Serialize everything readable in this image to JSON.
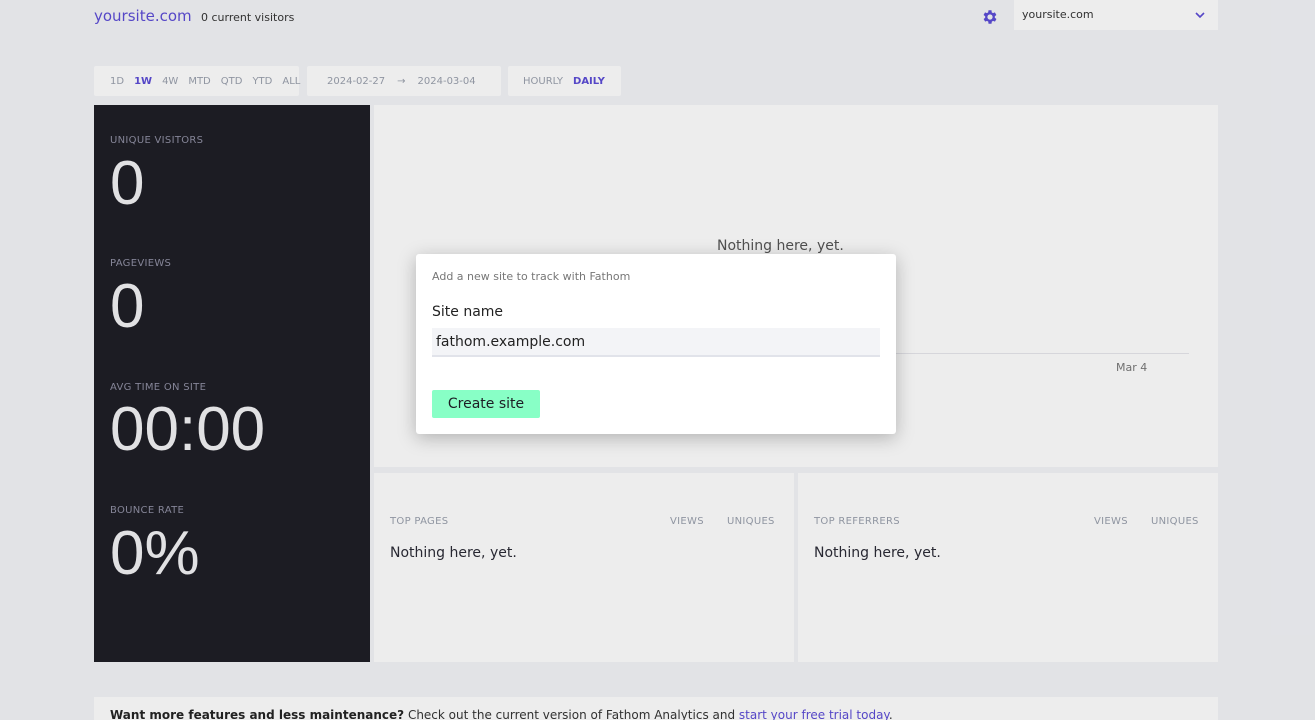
{
  "header": {
    "site_title": "yoursite.com",
    "current_visitors": "0 current visitors",
    "settings_icon": "gear-icon",
    "site_selector": {
      "selected": "yoursite.com",
      "icon": "chevron-down-icon"
    }
  },
  "filters": {
    "periods": [
      {
        "label": "1D",
        "active": false
      },
      {
        "label": "1W",
        "active": true
      },
      {
        "label": "4W",
        "active": false
      },
      {
        "label": "MTD",
        "active": false
      },
      {
        "label": "QTD",
        "active": false
      },
      {
        "label": "YTD",
        "active": false
      },
      {
        "label": "ALL",
        "active": false
      }
    ],
    "start_date": "2024-02-27",
    "date_separator": "→",
    "end_date": "2024-03-04",
    "granularity": [
      {
        "label": "HOURLY",
        "active": false
      },
      {
        "label": "DAILY",
        "active": true
      }
    ]
  },
  "stats": {
    "unique_visitors": {
      "label": "Unique visitors",
      "value": "0"
    },
    "pageviews": {
      "label": "Pageviews",
      "value": "0"
    },
    "avg_time": {
      "label": "Avg time on site",
      "value": "00:00"
    },
    "bounce_rate": {
      "label": "Bounce rate",
      "value": "0%"
    }
  },
  "chart": {
    "empty_text": "Nothing here, yet.",
    "tick_label": "Mar 4"
  },
  "top_pages": {
    "title": "Top pages",
    "col_views": "Views",
    "col_uniques": "Uniques",
    "empty_text": "Nothing here, yet."
  },
  "top_referrers": {
    "title": "Top referrers",
    "col_views": "Views",
    "col_uniques": "Uniques",
    "empty_text": "Nothing here, yet."
  },
  "footer": {
    "bold": "Want more features and less maintenance?",
    "text": " Check out the current version of Fathom Analytics and ",
    "link": "start your free trial today",
    "end": "."
  },
  "modal": {
    "heading": "Add a new site to track with Fathom",
    "label": "Site name",
    "input_value": "fathom.example.com",
    "button": "Create site"
  },
  "colors": {
    "accent": "#5b4bd6",
    "dark_panel": "#1d1d24",
    "button_green": "#88ffc6"
  }
}
